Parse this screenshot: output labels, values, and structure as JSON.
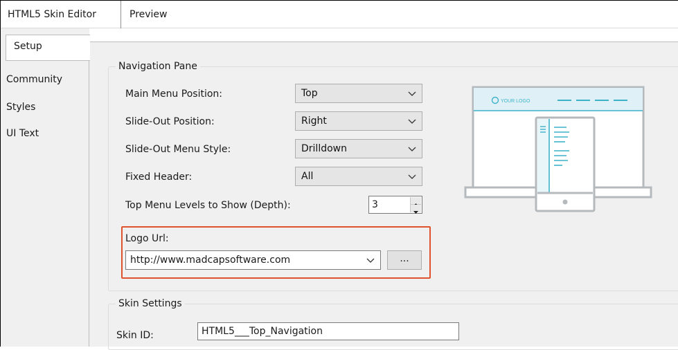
{
  "editor_tabs": [
    "HTML5 Skin Editor",
    "Preview"
  ],
  "side_tabs": [
    "Setup",
    "Community",
    "Styles",
    "UI Text"
  ],
  "navigation_pane": {
    "legend": "Navigation Pane",
    "main_menu_position": {
      "label": "Main Menu Position:",
      "value": "Top"
    },
    "slide_out_position": {
      "label": "Slide-Out Position:",
      "value": "Right"
    },
    "slide_out_menu_style": {
      "label": "Slide-Out Menu Style:",
      "value": "Drilldown"
    },
    "fixed_header": {
      "label": "Fixed Header:",
      "value": "All"
    },
    "top_menu_levels": {
      "label": "Top Menu Levels to Show (Depth):",
      "value": "3"
    },
    "logo_url": {
      "label": "Logo Url:",
      "value": "http://www.madcapsoftware.com",
      "browse_label": "..."
    }
  },
  "preview_logo_text": "YOUR LOGO",
  "skin_settings": {
    "legend": "Skin Settings",
    "skin_id": {
      "label": "Skin ID:",
      "value": "HTML5___Top_Navigation"
    }
  },
  "colors": {
    "accent": "#3cb2c9",
    "highlight": "#e0522d",
    "device": "#b4b9bd"
  }
}
